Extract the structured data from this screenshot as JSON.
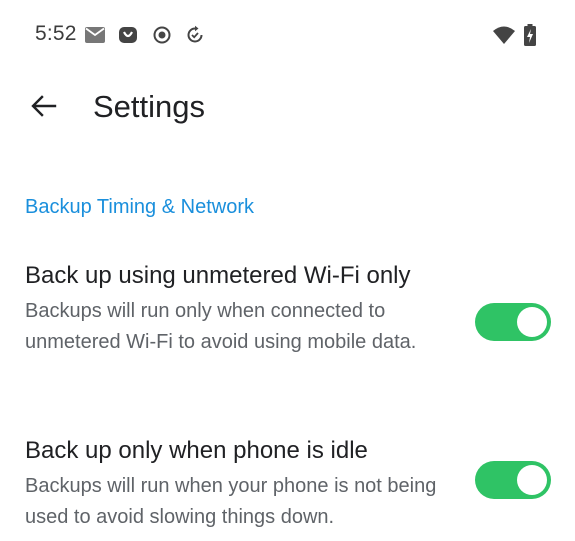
{
  "status_bar": {
    "time": "5:52",
    "left_icons": [
      "mail-icon",
      "bag-icon",
      "record-icon",
      "sync-icon"
    ],
    "right_icons": [
      "wifi-icon",
      "battery-charging-icon"
    ]
  },
  "toolbar": {
    "back_icon": "arrow-back-icon",
    "title": "Settings"
  },
  "section": {
    "title": "Backup Timing & Network",
    "accent_color": "#1a8fdc"
  },
  "preferences": [
    {
      "title": "Back up using unmetered Wi-Fi only",
      "summary": "Backups will run only when connected to unmetered Wi-Fi to avoid using mobile data.",
      "enabled": true
    },
    {
      "title": "Back up only when phone is idle",
      "summary": "Backups will run when your phone is not being used to avoid slowing things down.",
      "enabled": true
    }
  ],
  "colors": {
    "switch_on": "#2fc365",
    "text_primary": "#202124",
    "text_secondary": "#5f6368"
  }
}
